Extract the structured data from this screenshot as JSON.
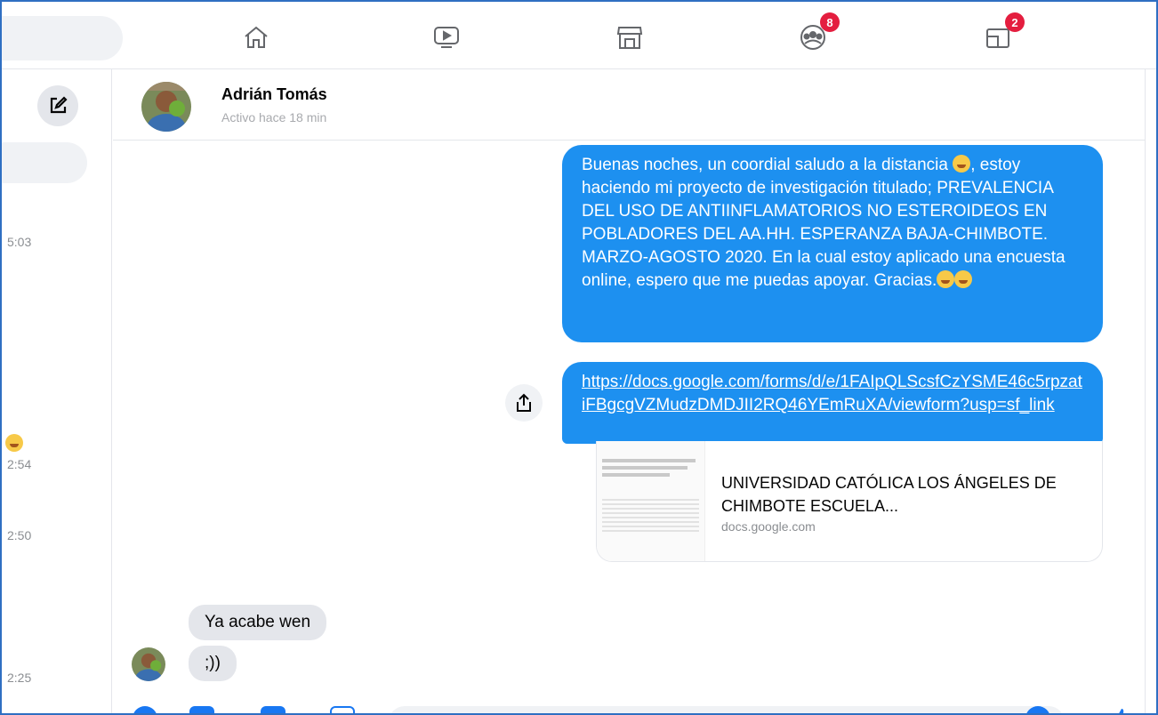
{
  "nav": {
    "items": [
      {
        "name": "home-icon"
      },
      {
        "name": "watch-icon"
      },
      {
        "name": "marketplace-icon"
      },
      {
        "name": "groups-icon",
        "badge": "8"
      },
      {
        "name": "gaming-icon",
        "badge": "2"
      }
    ]
  },
  "sidebar": {
    "times": [
      "5:03",
      "2:54",
      "2:50",
      "2:25"
    ]
  },
  "chat": {
    "contact_name": "Adrián Tomás",
    "contact_status": "Activo hace 18 min"
  },
  "messages": {
    "m1": {
      "part1": "Buenas noches, un coordial saludo a la distancia ",
      "part2": ", estoy haciendo mi proyecto de investigación titulado;  PREVALENCIA DEL USO DE ANTIINFLAMATORIOS NO ESTEROIDEOS EN POBLADORES DEL AA.HH. ESPERANZA BAJA-CHIMBOTE. MARZO-AGOSTO 2020. En la cual estoy aplicado una encuesta online, espero que me puedas apoyar. Gracias."
    },
    "m2": {
      "link": "https://docs.google.com/forms/d/e/1FAIpQLScsfCzYSME46c5rpzatiFBgcgVZMudzDMDJII2RQ46YEmRuXA/viewform?usp=sf_link"
    },
    "preview": {
      "title": "UNIVERSIDAD CATÓLICA LOS ÁNGELES DE CHIMBOTE ESCUELA...",
      "domain": "docs.google.com"
    },
    "incoming": [
      "Ya acabe wen",
      ";))"
    ]
  },
  "colors": {
    "outgoing_bubble": "#1d90f0",
    "incoming_bubble": "#e4e6eb",
    "badge": "#e41e3f",
    "frame_border": "#2f6fc2"
  }
}
